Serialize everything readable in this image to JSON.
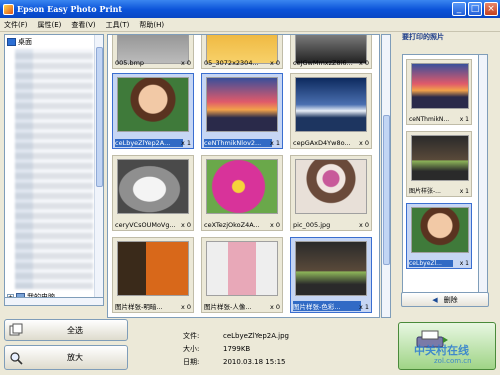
{
  "window": {
    "title": "Epson Easy Photo Print",
    "controls": [
      "_",
      "□",
      "×"
    ]
  },
  "menu": [
    "文件(F)",
    "属性(E)",
    "查看(V)",
    "工具(T)",
    "帮助(H)"
  ],
  "tree": {
    "root_label": "桌面",
    "bottom_label": "我的电脑"
  },
  "grid": {
    "tiles": [
      {
        "caption": "005.bmp",
        "count": "x 0",
        "selected": false
      },
      {
        "caption": "05_3072x2304...",
        "count": "x 0",
        "selected": false
      },
      {
        "caption": "ceJGwMmxzZ8i6...",
        "count": "x 0",
        "selected": false
      },
      {
        "caption": "ceLbyeZlYep2A...",
        "count": "x 1",
        "selected": true
      },
      {
        "caption": "ceNThmikNlov2...",
        "count": "x 1",
        "selected": true
      },
      {
        "caption": "cepGAxD4Yw8o...",
        "count": "x 0",
        "selected": false
      },
      {
        "caption": "ceryVCsOUMoVg...",
        "count": "x 0",
        "selected": false
      },
      {
        "caption": "ceXTezjOkoZ4A...",
        "count": "x 0",
        "selected": false
      },
      {
        "caption": "pic_005.jpg",
        "count": "x 0",
        "selected": false
      },
      {
        "caption": "图片样张-明暗...",
        "count": "x 0",
        "selected": false
      },
      {
        "caption": "图片样张-人像...",
        "count": "x 0",
        "selected": false
      },
      {
        "caption": "图片样张-色彩...",
        "count": "x 1",
        "selected": true
      }
    ]
  },
  "right_panel": {
    "header": "要打印的照片",
    "items": [
      {
        "caption": "ceNThmikN...",
        "count": "x 1",
        "selected": false
      },
      {
        "caption": "图片样张-...",
        "count": "x 1",
        "selected": false
      },
      {
        "caption": "ceLbyeZl...",
        "count": "x 1",
        "selected": true
      }
    ],
    "delete_label": "删除"
  },
  "buttons": {
    "select_all": "全选",
    "zoom": "放大"
  },
  "info": {
    "file_label": "文件:",
    "file_value": "ceLbyeZlYep2A.jpg",
    "size_label": "大小:",
    "size_value": "1799KB",
    "date_label": "日期:",
    "date_value": "2010.03.18 15:15"
  },
  "watermark": {
    "text": "中关村在线",
    "sub": "zol.com.cn"
  }
}
